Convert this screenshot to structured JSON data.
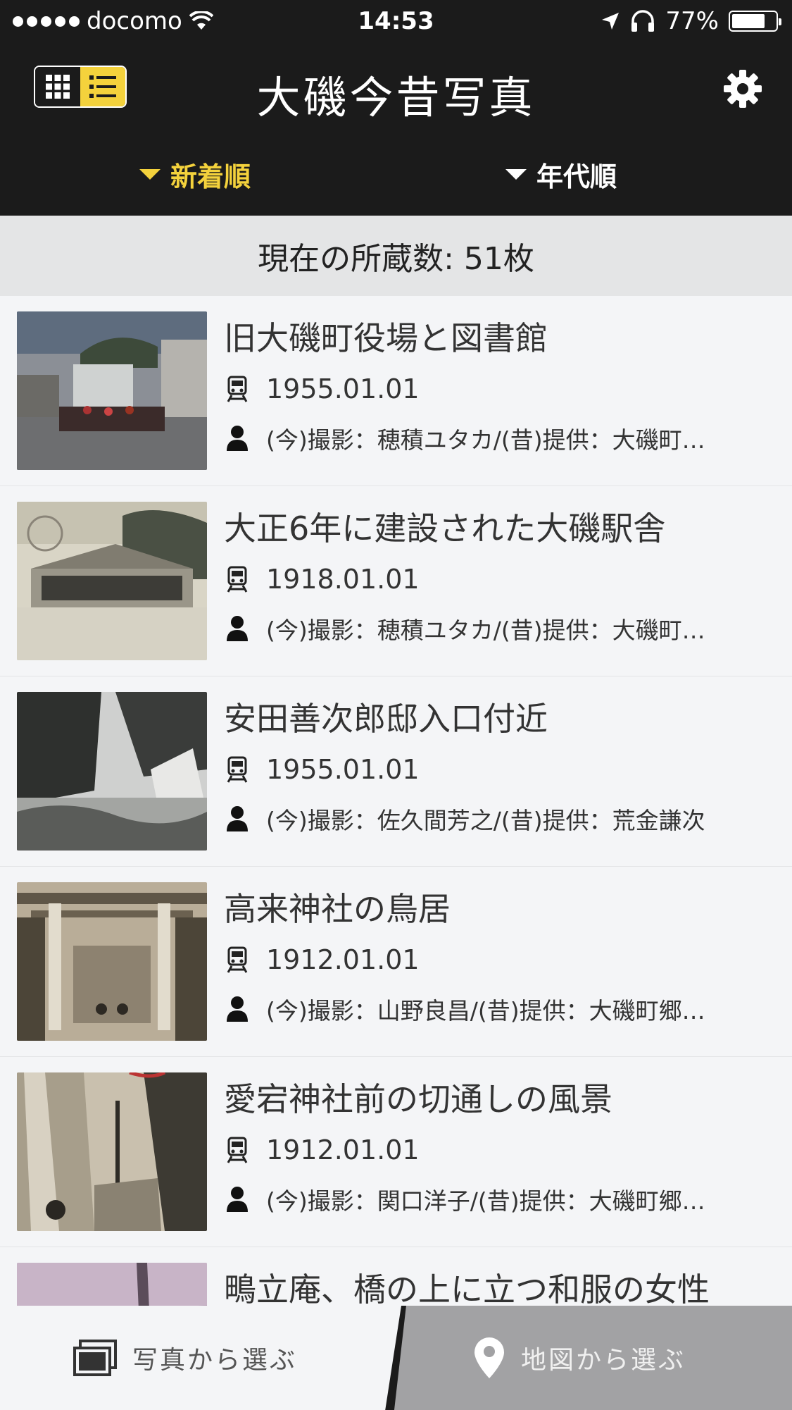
{
  "status_bar": {
    "carrier": "docomo",
    "time": "14:53",
    "battery": "77%",
    "battery_level": 0.77
  },
  "header": {
    "title": "大磯今昔写真",
    "view_toggle": {
      "grid_icon": "grid-icon",
      "list_icon": "list-icon",
      "selected": "list"
    },
    "settings_icon": "gear-icon",
    "sort_tabs": [
      {
        "label": "新着順",
        "active": true
      },
      {
        "label": "年代順",
        "active": false
      }
    ],
    "accent_color": "#f4d23c",
    "background_color": "#1b1b1b"
  },
  "count_bar": {
    "text": "現在の所蔵数: 51枚"
  },
  "photos": [
    {
      "title": "旧大磯町役場と図書館",
      "date": "1955.01.01",
      "credit": "(今)撮影：穂積ユタカ/(昔)提供：大磯町…"
    },
    {
      "title": "大正6年に建設された大磯駅舎",
      "date": "1918.01.01",
      "credit": "(今)撮影：穂積ユタカ/(昔)提供：大磯町…"
    },
    {
      "title": "安田善次郎邸入口付近",
      "date": "1955.01.01",
      "credit": "(今)撮影：佐久間芳之/(昔)提供：荒金謙次"
    },
    {
      "title": "高来神社の鳥居",
      "date": "1912.01.01",
      "credit": "(今)撮影：山野良昌/(昔)提供：大磯町郷…"
    },
    {
      "title": "愛宕神社前の切通しの風景",
      "date": "1912.01.01",
      "credit": "(今)撮影：関口洋子/(昔)提供：大磯町郷…"
    },
    {
      "title": "鴫立庵、橋の上に立つ和服の女性",
      "date": "",
      "credit": ""
    }
  ],
  "bottom_tabs": [
    {
      "label": "写真から選ぶ",
      "icon": "photos-icon",
      "active": true
    },
    {
      "label": "地図から選ぶ",
      "icon": "map-pin-icon",
      "active": false
    }
  ]
}
